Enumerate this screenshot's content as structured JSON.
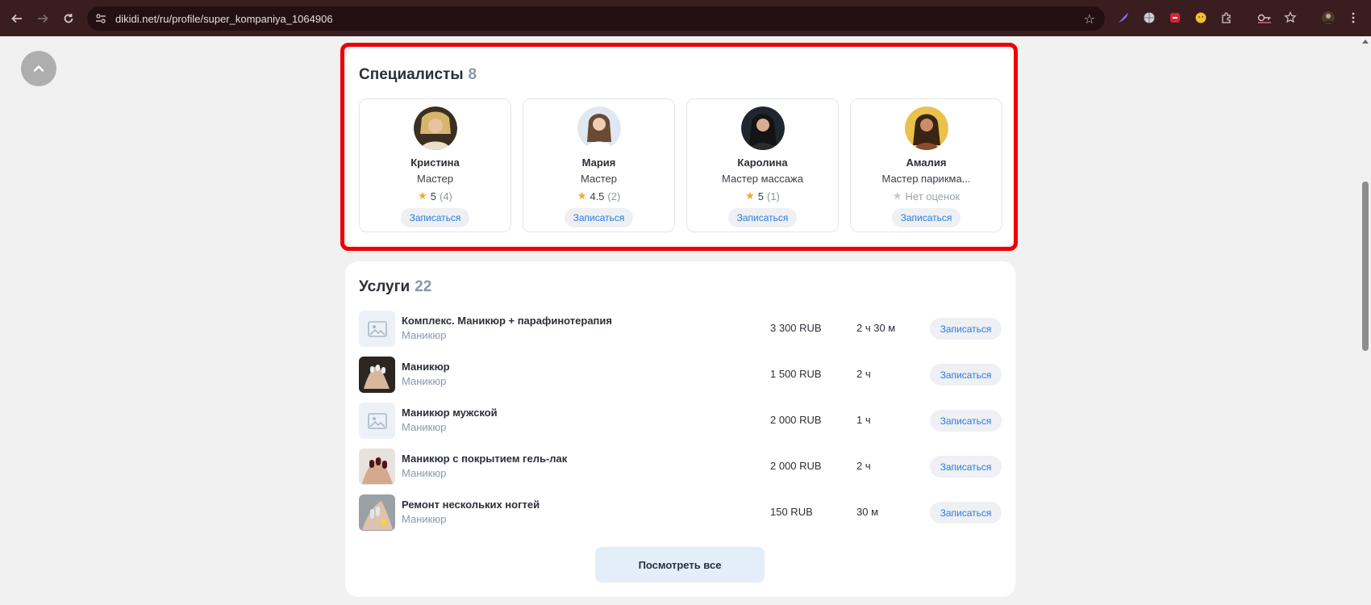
{
  "browser": {
    "url": "dikidi.net/ru/profile/super_kompaniya_1064906",
    "back_icon": "arrow-left-icon",
    "forward_icon": "arrow-right-icon",
    "reload_icon": "reload-icon",
    "site_info_icon": "tune-icon",
    "bookmark_icon": "star-icon"
  },
  "specialists": {
    "title": "Специалисты",
    "count": "8",
    "items": [
      {
        "name": "Кристина",
        "role": "Мастер",
        "rating": "5",
        "reviews": "(4)",
        "book": "Записаться"
      },
      {
        "name": "Мария",
        "role": "Мастер",
        "rating": "4.5",
        "reviews": "(2)",
        "book": "Записаться"
      },
      {
        "name": "Каролина",
        "role": "Мастер массажа",
        "rating": "5",
        "reviews": "(1)",
        "book": "Записаться"
      },
      {
        "name": "Амалия",
        "role": "Мастер парикма...",
        "rating": "Нет оценок",
        "reviews": "",
        "book": "Записаться"
      }
    ]
  },
  "services": {
    "title": "Услуги",
    "count": "22",
    "items": [
      {
        "name": "Комплекс. Маникюр + парафинотерапия",
        "category": "Маникюр",
        "price": "3 300 RUB",
        "duration": "2 ч 30 м",
        "book": "Записаться"
      },
      {
        "name": "Маникюр",
        "category": "Маникюр",
        "price": "1 500 RUB",
        "duration": "2 ч",
        "book": "Записаться"
      },
      {
        "name": "Маникюр мужской",
        "category": "Маникюр",
        "price": "2 000 RUB",
        "duration": "1 ч",
        "book": "Записаться"
      },
      {
        "name": "Маникюр с покрытием гель-лак",
        "category": "Маникюр",
        "price": "2 000 RUB",
        "duration": "2 ч",
        "book": "Записаться"
      },
      {
        "name": "Ремонт нескольких ногтей",
        "category": "Маникюр",
        "price": "150 RUB",
        "duration": "30 м",
        "book": "Записаться"
      }
    ],
    "view_all": "Посмотреть все"
  },
  "colors": {
    "accent": "#2a7be4",
    "highlight": "#ee0000",
    "star": "#f5a623"
  }
}
